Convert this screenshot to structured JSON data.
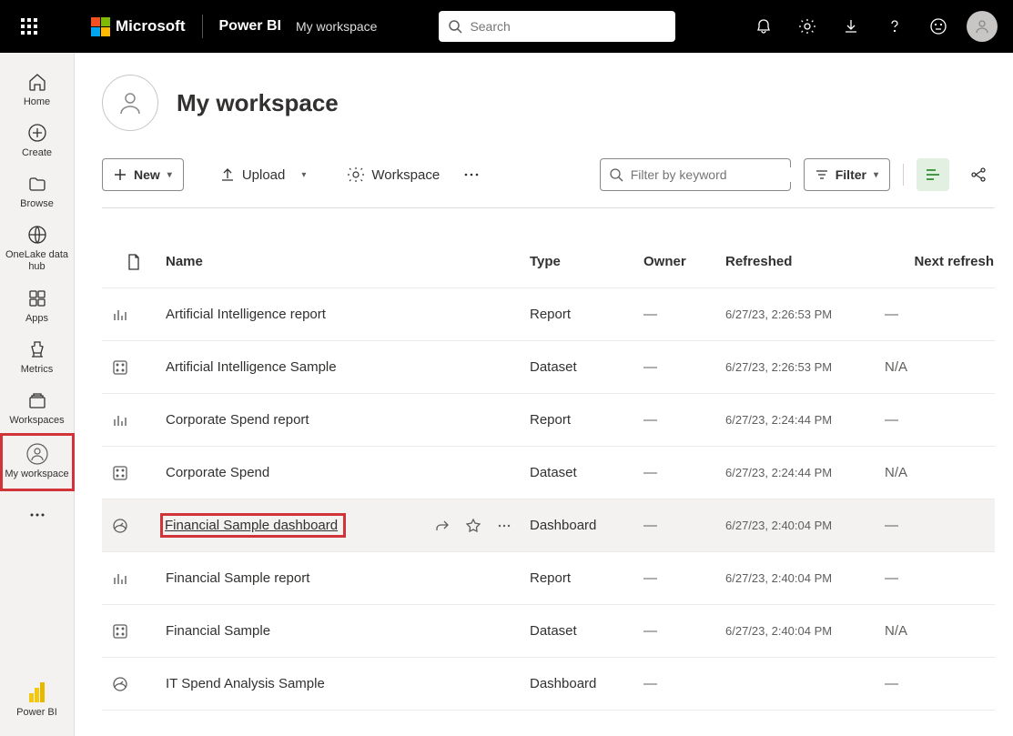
{
  "topbar": {
    "brand": "Microsoft",
    "product": "Power BI",
    "breadcrumb": "My workspace",
    "search_placeholder": "Search"
  },
  "leftnav": {
    "items": [
      {
        "label": "Home"
      },
      {
        "label": "Create"
      },
      {
        "label": "Browse"
      },
      {
        "label": "OneLake data hub"
      },
      {
        "label": "Apps"
      },
      {
        "label": "Metrics"
      },
      {
        "label": "Workspaces"
      },
      {
        "label": "My workspace"
      }
    ],
    "footer": "Power BI"
  },
  "workspace": {
    "title": "My workspace"
  },
  "toolbar": {
    "new": "New",
    "upload": "Upload",
    "settings": "Workspace",
    "filter_placeholder": "Filter by keyword",
    "filter_btn": "Filter"
  },
  "columns": {
    "name": "Name",
    "type": "Type",
    "owner": "Owner",
    "refreshed": "Refreshed",
    "next": "Next refresh"
  },
  "rows": [
    {
      "name": "Artificial Intelligence report",
      "type": "Report",
      "owner": "—",
      "refreshed": "6/27/23, 2:26:53 PM",
      "next": "—",
      "icon": "report"
    },
    {
      "name": "Artificial Intelligence Sample",
      "type": "Dataset",
      "owner": "—",
      "refreshed": "6/27/23, 2:26:53 PM",
      "next": "N/A",
      "icon": "dataset"
    },
    {
      "name": "Corporate Spend report",
      "type": "Report",
      "owner": "—",
      "refreshed": "6/27/23, 2:24:44 PM",
      "next": "—",
      "icon": "report"
    },
    {
      "name": "Corporate Spend",
      "type": "Dataset",
      "owner": "—",
      "refreshed": "6/27/23, 2:24:44 PM",
      "next": "N/A",
      "icon": "dataset"
    },
    {
      "name": "Financial Sample dashboard",
      "type": "Dashboard",
      "owner": "—",
      "refreshed": "6/27/23, 2:40:04 PM",
      "next": "—",
      "icon": "dashboard"
    },
    {
      "name": "Financial Sample report",
      "type": "Report",
      "owner": "—",
      "refreshed": "6/27/23, 2:40:04 PM",
      "next": "—",
      "icon": "report"
    },
    {
      "name": "Financial Sample",
      "type": "Dataset",
      "owner": "—",
      "refreshed": "6/27/23, 2:40:04 PM",
      "next": "N/A",
      "icon": "dataset"
    },
    {
      "name": "IT Spend Analysis Sample",
      "type": "Dashboard",
      "owner": "—",
      "refreshed": "",
      "next": "—",
      "icon": "dashboard"
    }
  ]
}
